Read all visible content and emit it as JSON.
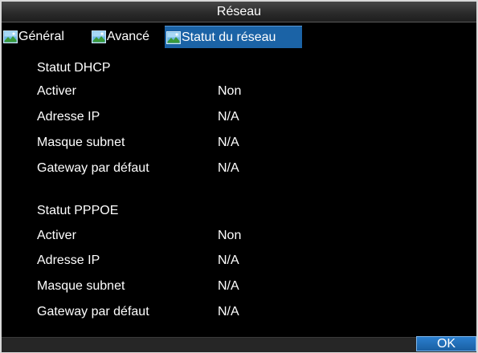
{
  "window": {
    "title": "Réseau"
  },
  "tabs": [
    {
      "label": "Général",
      "icon": "network-tab-icon",
      "active": false
    },
    {
      "label": "Avancé",
      "icon": "network-tab-icon",
      "active": false
    },
    {
      "label": "Statut du réseau",
      "icon": "network-tab-icon",
      "active": true
    }
  ],
  "dhcp": {
    "heading": "Statut DHCP",
    "rows": [
      {
        "label": "Activer",
        "value": "Non"
      },
      {
        "label": "Adresse IP",
        "value": "N/A"
      },
      {
        "label": "Masque subnet",
        "value": "N/A"
      },
      {
        "label": "Gateway par défaut",
        "value": "N/A"
      }
    ]
  },
  "pppoe": {
    "heading": "Statut PPPOE",
    "rows": [
      {
        "label": "Activer",
        "value": "Non"
      },
      {
        "label": "Adresse IP",
        "value": "N/A"
      },
      {
        "label": "Masque subnet",
        "value": "N/A"
      },
      {
        "label": "Gateway par défaut",
        "value": "N/A"
      }
    ]
  },
  "footer": {
    "ok_label": "OK"
  },
  "colors": {
    "background": "#000000",
    "active_tab": "#1b63a6",
    "text": "#ffffff",
    "button": "#1a5fa2"
  }
}
